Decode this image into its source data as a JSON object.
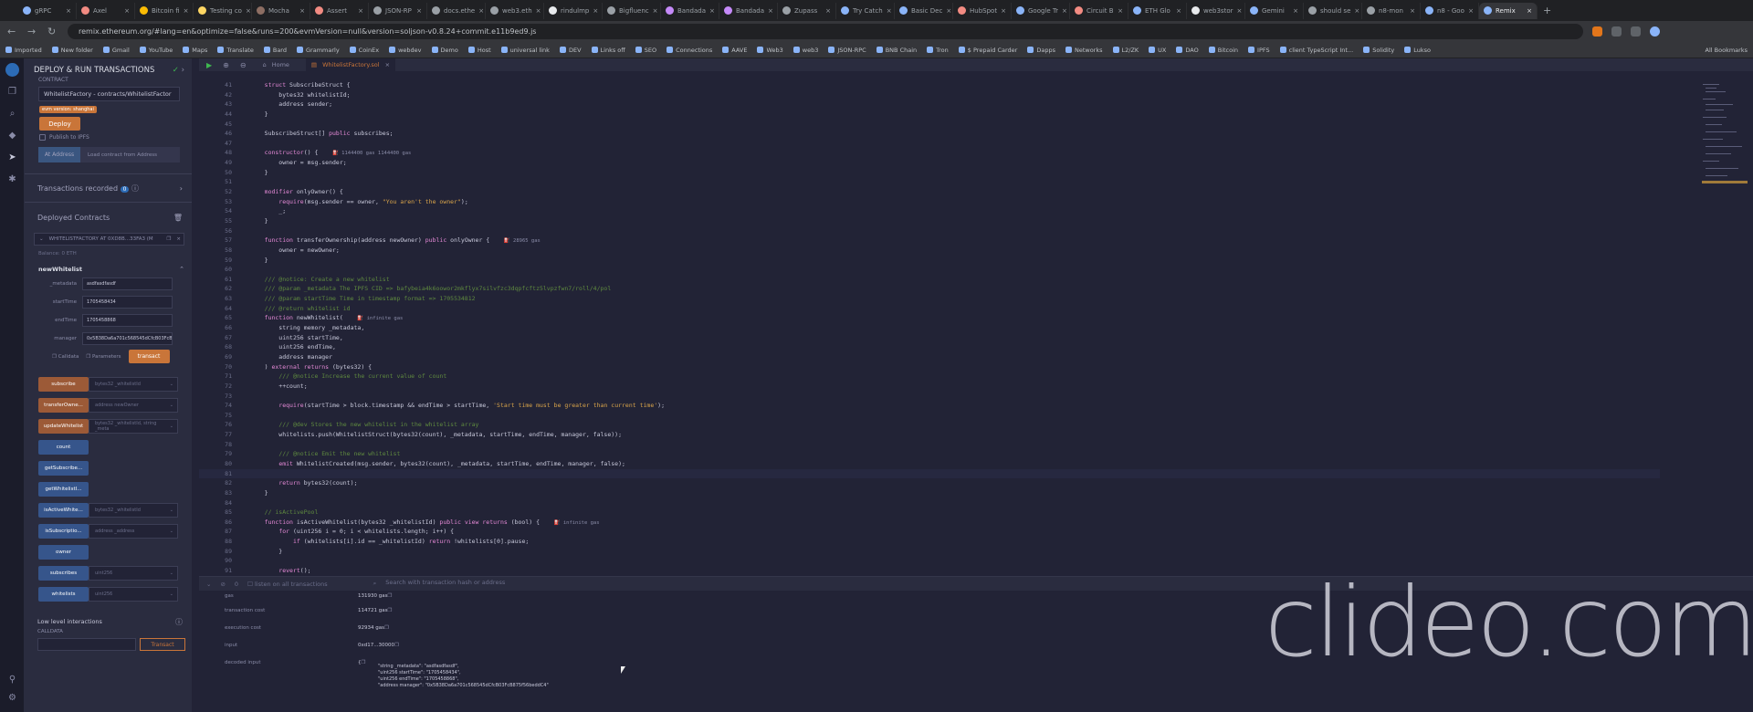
{
  "browser": {
    "tabs": [
      {
        "label": "gRPC",
        "color": "#8ab4f8"
      },
      {
        "label": "Axel",
        "color": "#f28b82"
      },
      {
        "label": "Bitcoin fi",
        "color": "#fbbc04"
      },
      {
        "label": "Testing co",
        "color": "#fdd663"
      },
      {
        "label": "Mocha",
        "color": "#8d6e63"
      },
      {
        "label": "Assert",
        "color": "#f28b82"
      },
      {
        "label": "JSON-RP",
        "color": "#9aa0a6"
      },
      {
        "label": "docs.ethe",
        "color": "#9aa0a6"
      },
      {
        "label": "web3.eth",
        "color": "#9aa0a6"
      },
      {
        "label": "rindulmp",
        "color": "#e8eaed"
      },
      {
        "label": "Bigfluenc",
        "color": "#9aa0a6"
      },
      {
        "label": "Bandada",
        "color": "#c58af9"
      },
      {
        "label": "Bandada",
        "color": "#c58af9"
      },
      {
        "label": "Zupass",
        "color": "#9aa0a6"
      },
      {
        "label": "Try Catch",
        "color": "#8ab4f8"
      },
      {
        "label": "Basic Dec",
        "color": "#8ab4f8"
      },
      {
        "label": "HubSpot",
        "color": "#f28b82"
      },
      {
        "label": "Google Tr",
        "color": "#8ab4f8"
      },
      {
        "label": "Circuit B",
        "color": "#f28b82"
      },
      {
        "label": "ETH Glo",
        "color": "#8ab4f8"
      },
      {
        "label": "web3stor",
        "color": "#e8eaed"
      },
      {
        "label": "Gemini",
        "color": "#8ab4f8"
      },
      {
        "label": "should se",
        "color": "#9aa0a6"
      },
      {
        "label": "n8-mon",
        "color": "#9aa0a6"
      },
      {
        "label": "n8 - Goo",
        "color": "#8ab4f8"
      },
      {
        "label": "Remix",
        "color": "#8ab4f8",
        "active": true
      }
    ],
    "url": "remix.ethereum.org/#lang=en&optimize=false&runs=200&evmVersion=null&version=soljson-v0.8.24+commit.e11b9ed9.js",
    "bookmarks": [
      "Imported",
      "New folder",
      "Gmail",
      "YouTube",
      "Maps",
      "Translate",
      "Bard",
      "Grammarly",
      "CoinEx",
      "webdev",
      "Demo",
      "Host",
      "universal link",
      "DEV",
      "Links off",
      "SEO",
      "Connections",
      "AAVE",
      "Web3",
      "web3",
      "JSON-RPC",
      "BNB Chain",
      "Tron",
      "$ Prepaid Carder",
      "Dapps",
      "Networks",
      "L2/ZK",
      "UX",
      "DAO",
      "Bitcoin",
      "IPFS",
      "client TypeScript Int...",
      "Solidity",
      "Lukso"
    ],
    "all_bookmarks": "All Bookmarks"
  },
  "sidepanel": {
    "title": "DEPLOY & RUN TRANSACTIONS",
    "contract_label": "CONTRACT",
    "contract_value": "WhitelistFactory - contracts/WhitelistFactor",
    "evm_badge": "evm version: shanghai",
    "deploy_label": "Deploy",
    "publish_label": "Publish to IPFS",
    "at_address_label": "At Address",
    "load_contract_label": "Load contract from Address",
    "tx_recorded_label": "Transactions recorded",
    "tx_recorded_count": "0",
    "deployed_label": "Deployed Contracts",
    "instance_label": "WHITELISTFACTORY AT 0XD8B...33FA3 (M",
    "balance_label": "Balance: 0 ETH",
    "fn_expanded": "newWhitelist",
    "params": [
      {
        "name": "_metadata",
        "value": "asdfasdfasdf"
      },
      {
        "name": "startTime",
        "value": "1705458434"
      },
      {
        "name": "endTime",
        "value": "1705458868"
      },
      {
        "name": "manager",
        "value": "0x5B38Da6a701c568545dCfcB03FcB875"
      }
    ],
    "calldata_label": "Calldata",
    "parameters_label": "Parameters",
    "transact_label": "transact",
    "functions": [
      {
        "label": "subscribe",
        "type": "o",
        "input": "bytes32 _whitelistId"
      },
      {
        "label": "transferOwne...",
        "type": "o",
        "input": "address newOwner"
      },
      {
        "label": "updateWhitelist",
        "type": "o",
        "input": "bytes32 _whitelistId, string _meta"
      },
      {
        "label": "count",
        "type": "b",
        "input": ""
      },
      {
        "label": "getSubscribe...",
        "type": "b",
        "input": ""
      },
      {
        "label": "getWhitelistI...",
        "type": "b",
        "input": ""
      },
      {
        "label": "isActiveWhite...",
        "type": "b",
        "input": "bytes32 _whitelistId"
      },
      {
        "label": "isSubscriptio...",
        "type": "b",
        "input": "address _address"
      },
      {
        "label": "owner",
        "type": "b",
        "input": ""
      },
      {
        "label": "subscribes",
        "type": "b",
        "input": "uint256"
      },
      {
        "label": "whitelists",
        "type": "b",
        "input": "uint256"
      }
    ],
    "low_level_label": "Low level interactions",
    "calldata_section_label": "CALLDATA",
    "transact_low_label": "Transact"
  },
  "editor": {
    "home_tab": "Home",
    "file_tab": "WhitelistFactory.sol",
    "lines": [
      {
        "n": "41",
        "html": "    <span class=\"kw\">struct</span> SubscribeStruct {"
      },
      {
        "n": "42",
        "html": "        bytes32 whitelistId;"
      },
      {
        "n": "43",
        "html": "        address sender;"
      },
      {
        "n": "44",
        "html": "    }"
      },
      {
        "n": "45",
        "html": ""
      },
      {
        "n": "46",
        "html": "    SubscribeStruct[] <span class=\"kw\">public</span> subscribes;"
      },
      {
        "n": "47",
        "html": ""
      },
      {
        "n": "48",
        "html": "    <span class=\"kw\">constructor</span>() {    <span class=\"gas\">⛽ 1144400 gas 1144400 gas</span>"
      },
      {
        "n": "49",
        "html": "        owner = msg.sender;"
      },
      {
        "n": "50",
        "html": "    }"
      },
      {
        "n": "51",
        "html": ""
      },
      {
        "n": "52",
        "html": "    <span class=\"kw\">modifier</span> onlyOwner() {"
      },
      {
        "n": "53",
        "html": "        <span class=\"kw\">require</span>(msg.sender == owner, <span class=\"st\">\"You aren't the owner\"</span>);"
      },
      {
        "n": "54",
        "html": "        _;"
      },
      {
        "n": "55",
        "html": "    }"
      },
      {
        "n": "56",
        "html": ""
      },
      {
        "n": "57",
        "html": "    <span class=\"kw\">function</span> transferOwnership(address newOwner) <span class=\"kw\">public</span> onlyOwner {    <span class=\"gas\">⛽ 28965 gas</span>"
      },
      {
        "n": "58",
        "html": "        owner = newOwner;"
      },
      {
        "n": "59",
        "html": "    }"
      },
      {
        "n": "60",
        "html": ""
      },
      {
        "n": "61",
        "html": "    <span class=\"cm\">/// @notice: Create a new whitelist</span>"
      },
      {
        "n": "62",
        "html": "    <span class=\"cm\">/// @param _metadata The IPFS CID => bafybeia4k6oowor2mkflyx7silvfzc3dqpfcftz5lvpzfwn7/roll/4/pol</span>"
      },
      {
        "n": "63",
        "html": "    <span class=\"cm\">/// @param startTime Time in timestamp format => 1705534812</span>"
      },
      {
        "n": "64",
        "html": "    <span class=\"cm\">/// @return whitelist id</span>"
      },
      {
        "n": "65",
        "html": "    <span class=\"kw\">function</span> newWhitelist(    <span class=\"gas\">⛽ infinite gas</span>"
      },
      {
        "n": "66",
        "html": "        string memory _metadata,"
      },
      {
        "n": "67",
        "html": "        uint256 startTime,"
      },
      {
        "n": "68",
        "html": "        uint256 endTime,"
      },
      {
        "n": "69",
        "html": "        address manager"
      },
      {
        "n": "70",
        "html": "    ) <span class=\"kw\">external returns</span> (bytes32) {"
      },
      {
        "n": "71",
        "html": "        <span class=\"cm\">/// @notice Increase the current value of count</span>"
      },
      {
        "n": "72",
        "html": "        ++count;"
      },
      {
        "n": "73",
        "html": ""
      },
      {
        "n": "74",
        "html": "        <span class=\"kw\">require</span>(startTime > block.timestamp && endTime > startTime, <span class=\"st\">'Start time must be greater than current time'</span>);"
      },
      {
        "n": "75",
        "html": ""
      },
      {
        "n": "76",
        "html": "        <span class=\"cm\">/// @dev Stores the new whitelist in the whitelist array</span>"
      },
      {
        "n": "77",
        "html": "        whitelists.push(WhitelistStruct(bytes32(count), _metadata, startTime, endTime, manager, false));"
      },
      {
        "n": "78",
        "html": ""
      },
      {
        "n": "79",
        "html": "        <span class=\"cm\">/// @notice Emit the new whitelist</span>"
      },
      {
        "n": "80",
        "html": "        <span class=\"kw\">emit</span> WhitelistCreated(msg.sender, bytes32(count), _metadata, startTime, endTime, manager, false);"
      },
      {
        "n": "81",
        "html": "",
        "hl": true
      },
      {
        "n": "82",
        "html": "        <span class=\"kw\">return</span> bytes32(count);"
      },
      {
        "n": "83",
        "html": "    }"
      },
      {
        "n": "84",
        "html": ""
      },
      {
        "n": "85",
        "html": "    <span class=\"cm\">// isActivePool</span>"
      },
      {
        "n": "86",
        "html": "    <span class=\"kw\">function</span> isActiveWhitelist(bytes32 _whitelistId) <span class=\"kw\">public view returns</span> (bool) {    <span class=\"gas\">⛽ infinite gas</span>"
      },
      {
        "n": "87",
        "html": "        <span class=\"kw\">for</span> (uint256 i = 0; i < whitelists.length; i++) {"
      },
      {
        "n": "88",
        "html": "            <span class=\"kw\">if</span> (whitelists[i].id == _whitelistId) <span class=\"kw\">return</span> !whitelists[0].pause;"
      },
      {
        "n": "89",
        "html": "        }"
      },
      {
        "n": "90",
        "html": ""
      },
      {
        "n": "91",
        "html": "        <span class=\"kw\">revert</span>();"
      }
    ]
  },
  "terminal": {
    "listen_label": "listen on all transactions",
    "search_placeholder": "Search with transaction hash or address",
    "rows": [
      {
        "k": "gas",
        "v": "131930 gas"
      },
      {
        "k": "transaction cost",
        "v": "114721 gas"
      },
      {
        "k": "execution cost",
        "v": "92934 gas"
      },
      {
        "k": "input",
        "v": "0xd17...30000"
      },
      {
        "k": "decoded input",
        "v": "{"
      }
    ],
    "decoded": [
      "\"string _metadata\": \"asdfasdfasdf\",",
      "\"uint256 startTime\": \"1705458434\",",
      "\"uint256 endTime\": \"1705458868\",",
      "\"address manager\": \"0x5B38Da6a701c568545dCfcB03FcB875f56beddC4\""
    ]
  },
  "watermark": "clideo.com"
}
